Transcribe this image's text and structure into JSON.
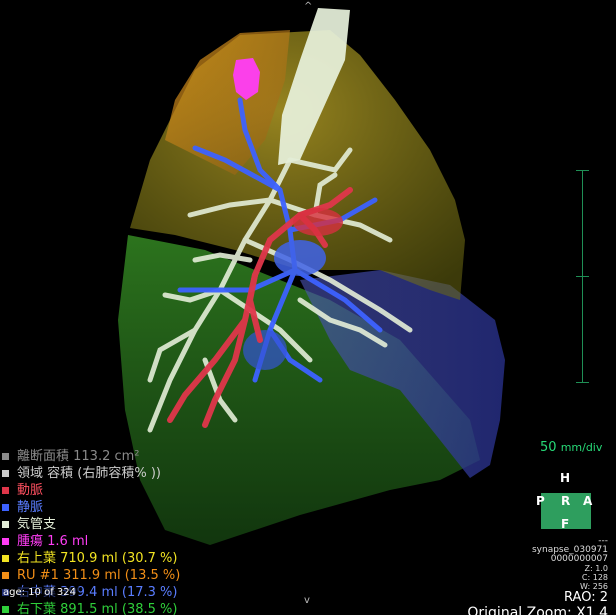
{
  "viewer": {
    "nav_up": "^",
    "nav_down": "v",
    "page_indicator": "age: 10 of 324"
  },
  "legend": [
    {
      "label": "離断面積 113.2 cm²",
      "color": "#8a8a8a"
    },
    {
      "label": "領域 容積 (右肺容積% ))",
      "color": "#cccccc"
    },
    {
      "label": "動脈",
      "color": "#e0364a"
    },
    {
      "label": "静脈",
      "color": "#3d62ff"
    },
    {
      "label": "気管支",
      "color": "#e4eed8"
    },
    {
      "label": "腫瘍 1.6 ml",
      "color": "#ff3df5"
    },
    {
      "label": "右上葉 710.9 ml (30.7 %)",
      "color": "#f2e422"
    },
    {
      "label": "RU #1 311.9 ml (13.5 %)",
      "color": "#f28f17"
    },
    {
      "label": "右中葉 399.4 ml (17.3 %)",
      "color": "#4a66ff"
    },
    {
      "label": "右下葉 891.5 ml (38.5 %)",
      "color": "#2fcf3a"
    }
  ],
  "scale": {
    "value": "50",
    "unit": "mm/div"
  },
  "orientation": {
    "top": "H",
    "left": "P",
    "center": "R",
    "right": "A",
    "bottom": "F"
  },
  "info": {
    "dots": "---",
    "series_name": "synapse_030971",
    "series_id": "0000000007",
    "z": "Z: 1.0",
    "c": "C: 128",
    "w": "W: 256",
    "view": "RAO: 2",
    "zoom": "Original Zoom: X1.4"
  },
  "colors": {
    "accent": "#27d977",
    "upper_lobe": "#f2e422",
    "ru1": "#f28f17",
    "middle_lobe": "#4a66ff",
    "lower_lobe": "#2fcf3a",
    "artery": "#e0364a",
    "vein": "#3d62ff",
    "bronchus": "#e4eed8",
    "tumor": "#ff3df5"
  }
}
